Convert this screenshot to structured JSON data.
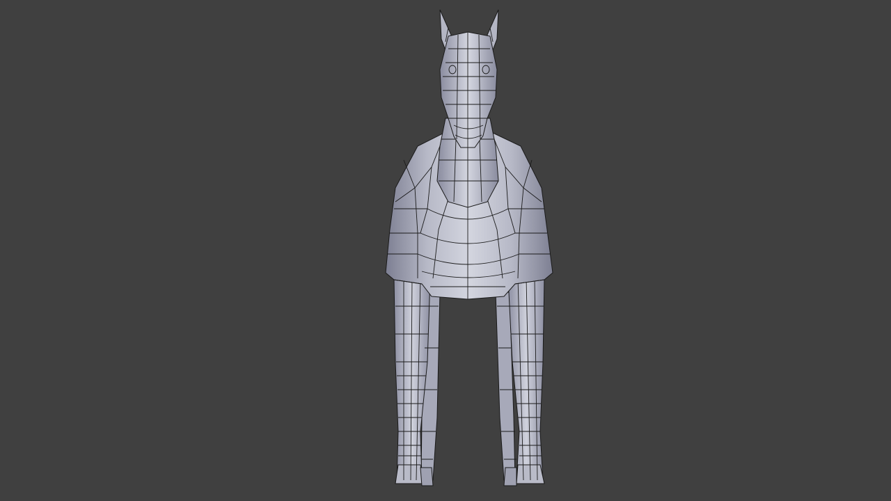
{
  "viewport": {
    "background_color": "#404040",
    "object": {
      "kind": "horse-mesh-wireframe",
      "shading": "solid-with-wireframe",
      "surface_color_light": "#c9cbd6",
      "surface_color_dark": "#7d7f92",
      "wire_color": "#1a1a1a"
    }
  }
}
